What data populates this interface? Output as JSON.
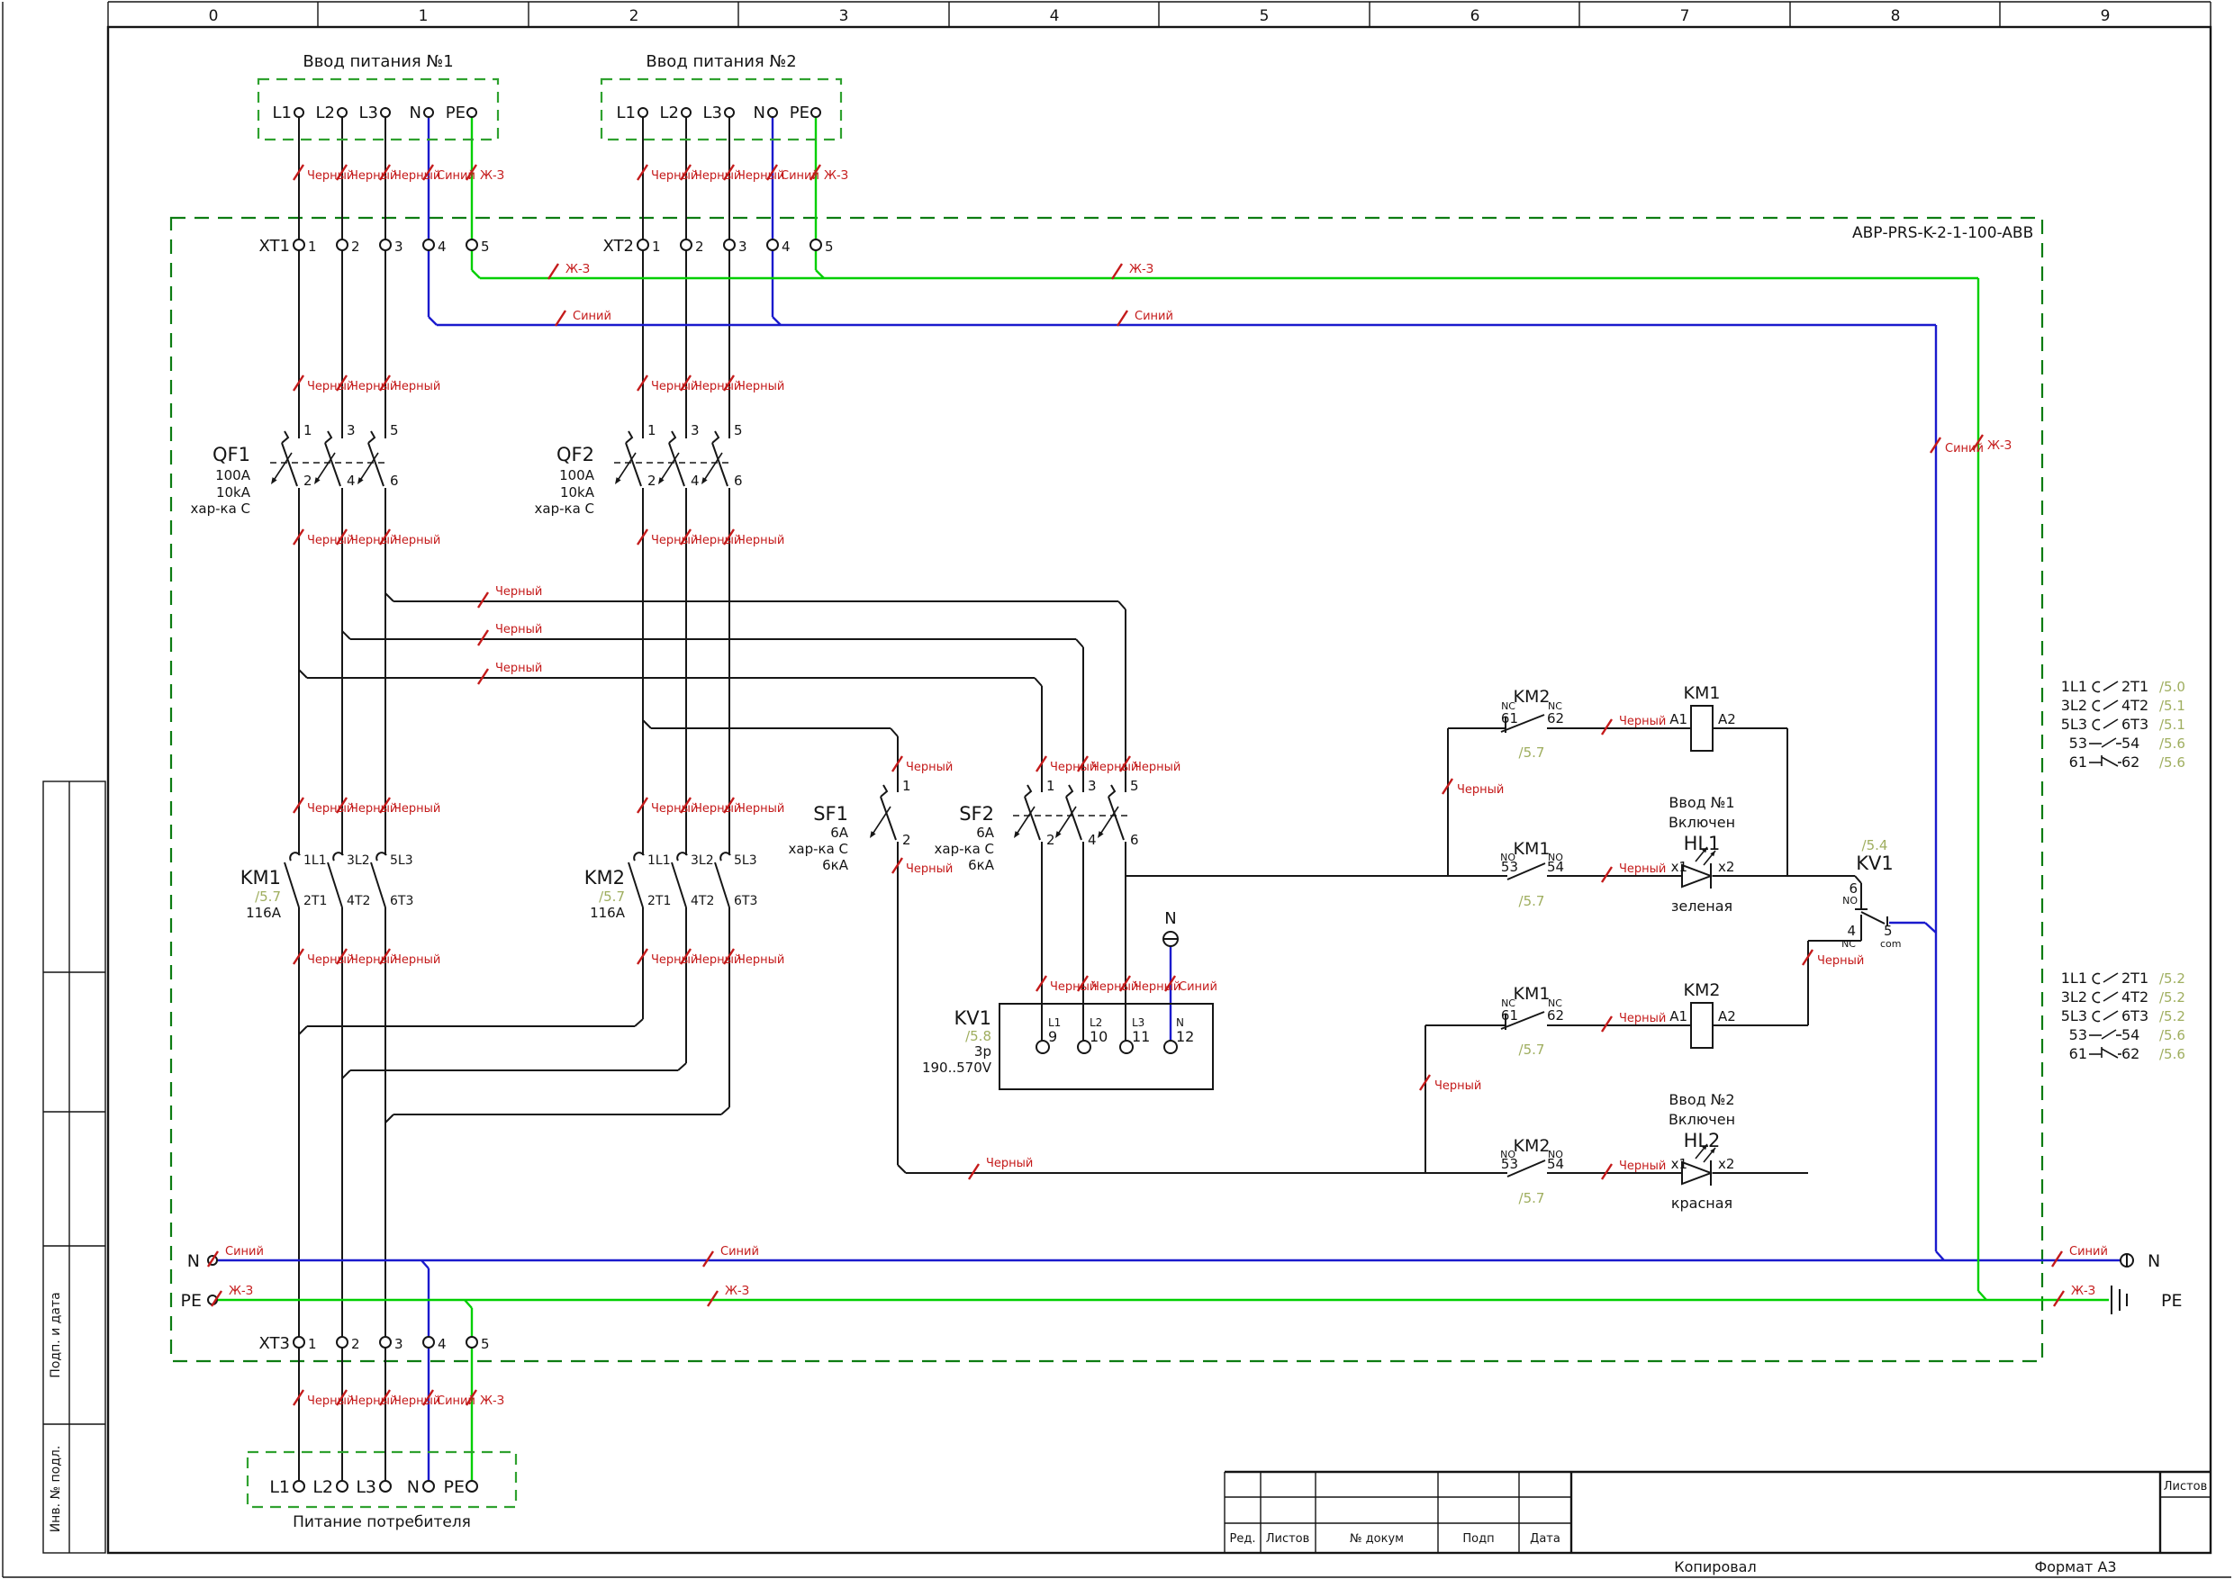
{
  "ruler": [
    "0",
    "1",
    "2",
    "3",
    "4",
    "5",
    "6",
    "7",
    "8",
    "9"
  ],
  "model": "АВР-PRS-K-2-1-100-ABB",
  "colors": {
    "black_label": "Черный",
    "blue_label": "Синий",
    "yg_label": "Ж-З",
    "wire_blue": "#1a1acd",
    "wire_green": "#00cf00",
    "cabinet_dash_green": "#0c7c12",
    "box_dash_green": "#2fa12f",
    "label_red": "#c41a1a",
    "ref_olive": "#9fae5f"
  },
  "feed1": {
    "title": "Ввод питания №1"
  },
  "feed2": {
    "title": "Ввод питания №2"
  },
  "consumer": {
    "title": "Питание потребителя"
  },
  "terms": {
    "l1": "L1",
    "l2": "L2",
    "l3": "L3",
    "n": "N",
    "pe": "PE"
  },
  "xt": {
    "x1": "XT1",
    "x2": "XT2",
    "x3": "XT3",
    "p1": "1",
    "p2": "2",
    "p3": "3",
    "p4": "4",
    "p5": "5"
  },
  "qf": {
    "n1": "QF1",
    "n2": "QF2",
    "amps": "100A",
    "ka": "10kA",
    "char": "хар-ка С",
    "pins": {
      "p1": "1",
      "p2": "2",
      "p3": "3",
      "p4": "4",
      "p5": "5",
      "p6": "6"
    }
  },
  "km": {
    "n1": "KM1",
    "n2": "KM2",
    "ref": "/5.7",
    "amps": "116A",
    "t1": "1L1",
    "t2": "3L2",
    "t3": "5L3",
    "b1": "2T1",
    "b2": "4T2",
    "b3": "6T3"
  },
  "sf": {
    "n1": "SF1",
    "n2": "SF2",
    "amps": "6А",
    "char": "хар-ка С",
    "ka": "6кА"
  },
  "kv": {
    "name": "KV1",
    "ref": "/5.8",
    "poles": "3p",
    "range": "190..570V",
    "tL1": "L1",
    "tL2": "L2",
    "tL3": "L3",
    "tN": "N",
    "p9": "9",
    "p10": "10",
    "p11": "11",
    "p12": "12",
    "cref": "/5.4",
    "no": "NO",
    "nc": "NC",
    "com": "com",
    "t4": "4",
    "t5": "5",
    "t6": "6"
  },
  "ctl": {
    "nc": "NC",
    "no": "NO",
    "c61": "61",
    "c62": "62",
    "c53": "53",
    "c54": "54",
    "a1": "A1",
    "a2": "A2",
    "x1": "x1",
    "x2": "x2",
    "ref": "/5.7",
    "b1": {
      "top": "KM2",
      "coil": "KM1",
      "bot": "KM1",
      "l1": "Ввод №1",
      "l2": "Включен",
      "lamp": "HL1",
      "color": "зеленая"
    },
    "b2": {
      "top": "KM1",
      "coil": "KM2",
      "bot": "KM2",
      "l1": "Ввод №2",
      "l2": "Включен",
      "lamp": "HL2",
      "color": "красная"
    }
  },
  "tbl1": {
    "rows": [
      {
        "l": "1L1",
        "r": "2T1",
        "ref": "/5.0"
      },
      {
        "l": "3L2",
        "r": "4T2",
        "ref": "/5.1"
      },
      {
        "l": "5L3",
        "r": "6T3",
        "ref": "/5.1"
      },
      {
        "l": "53",
        "r": "54",
        "ref": "/5.6"
      },
      {
        "l": "61",
        "r": "62",
        "ref": "/5.6"
      }
    ]
  },
  "tbl2": {
    "rows": [
      {
        "l": "1L1",
        "r": "2T1",
        "ref": "/5.2"
      },
      {
        "l": "3L2",
        "r": "4T2",
        "ref": "/5.2"
      },
      {
        "l": "5L3",
        "r": "6T3",
        "ref": "/5.2"
      },
      {
        "l": "53",
        "r": "54",
        "ref": "/5.6"
      },
      {
        "l": "61",
        "r": "62",
        "ref": "/5.6"
      }
    ]
  },
  "tb": {
    "red": "Ред.",
    "listov": "Листов",
    "doc": "№ докум",
    "podp": "Подп",
    "data": "Дата",
    "sheets": "Листов",
    "copied": "Копировал",
    "format": "Формат А3"
  },
  "side": {
    "podp": "Подп. и дата",
    "inv": "Инв. № подл."
  }
}
